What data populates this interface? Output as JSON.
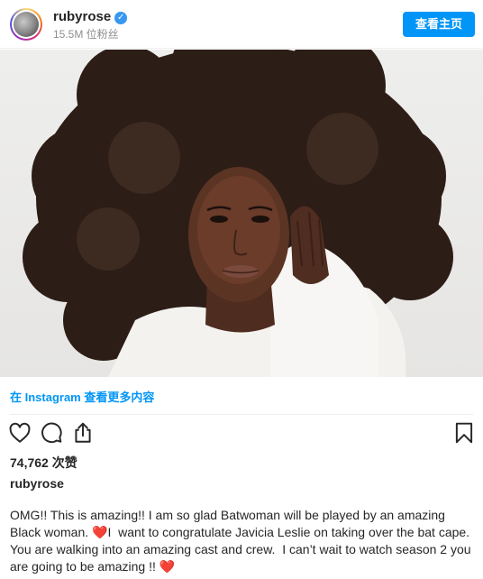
{
  "header": {
    "username": "rubyrose",
    "followers": "15.5M 位粉丝",
    "view_profile_label": "查看主页"
  },
  "post": {
    "view_on_instagram": "在 Instagram 查看更多内容",
    "likes": "74,762 次赞",
    "caption_user": "rubyrose",
    "caption_parts": [
      "OMG!! This is amazing!! I am so glad Batwoman will be played by an amazing Black woman. ",
      "❤️",
      "I  want to congratulate Javicia Leslie on taking over the bat cape.  You are walking into an amazing cast and crew.  I can’t wait to watch season 2 you are going to be amazing !! ",
      "❤️"
    ]
  },
  "icons": [
    "verified-badge-icon",
    "heart-icon",
    "comment-icon",
    "share-icon",
    "bookmark-icon"
  ],
  "colors": {
    "accent": "#0095f6",
    "text": "#262626",
    "muted": "#8e8e8e",
    "heart": "#ed1c24"
  }
}
